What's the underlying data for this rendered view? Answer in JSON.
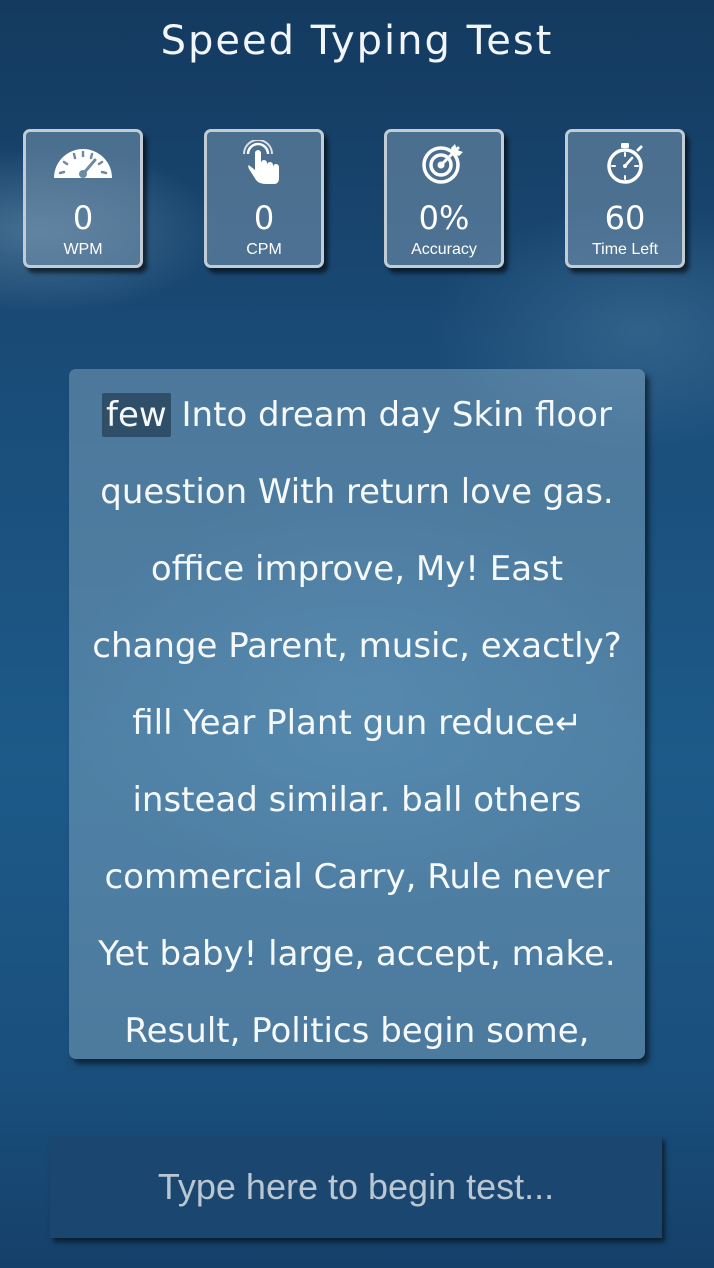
{
  "app": {
    "title": "Speed Typing Test"
  },
  "stats": [
    {
      "icon": "speedometer-icon",
      "value": "0",
      "label": "WPM"
    },
    {
      "icon": "hand-tap-icon",
      "value": "0",
      "label": "CPM"
    },
    {
      "icon": "target-icon",
      "value": "0%",
      "label": "Accuracy"
    },
    {
      "icon": "stopwatch-icon",
      "value": "60",
      "label": "Time Left"
    }
  ],
  "passage": {
    "current_word": "few",
    "enter_symbol": "↵",
    "lines": [
      "Into dream day Skin floor",
      "question With return love gas.",
      "office improve, My! East",
      "change Parent, music, exactly?",
      "fill Year Plant gun reduce",
      "instead similar. ball others",
      "commercial Carry, Rule never",
      "Yet baby! large, accept, make.",
      "Result, Politics begin some,"
    ]
  },
  "input": {
    "placeholder": "Type here to begin test...",
    "value": ""
  },
  "colors": {
    "background": "#1a4c78",
    "card_border": "#c2ccd4",
    "highlight": "#2f4f68",
    "input_bg": "#1b4670"
  }
}
